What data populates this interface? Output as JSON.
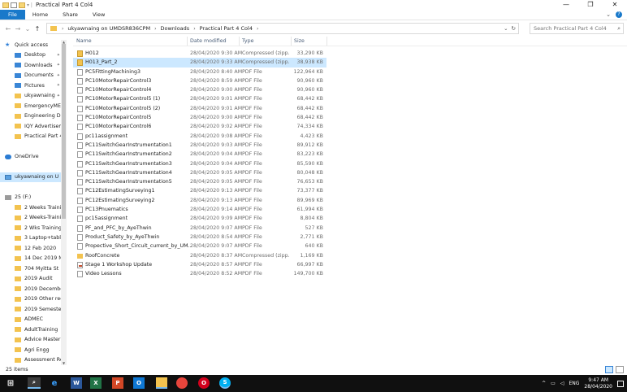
{
  "window": {
    "title": "Practical Part 4 Col4",
    "controls": [
      "—",
      "❐",
      "✕"
    ]
  },
  "ribbon": {
    "tabs": [
      "File",
      "Home",
      "Share",
      "View"
    ]
  },
  "address": {
    "path": [
      "ukyawnaing on UMDSR836CPM",
      "Downloads",
      "Practical Part 4 Col4"
    ]
  },
  "search": {
    "placeholder": "Search Practical Part 4 Col4"
  },
  "sidebar": {
    "items": [
      {
        "label": "Quick access",
        "icon": "star-icon"
      },
      {
        "label": "Desktop",
        "icon": "desktop-icon",
        "pinned": true
      },
      {
        "label": "Downloads",
        "icon": "downloads-icon",
        "pinned": true
      },
      {
        "label": "Documents",
        "icon": "documents-icon",
        "pinned": true
      },
      {
        "label": "Pictures",
        "icon": "pictures-icon",
        "pinned": true
      },
      {
        "label": "ukyawnaing",
        "icon": "folder-icon",
        "pinned": true
      },
      {
        "label": "EmergencyMEG",
        "icon": "folder-icon"
      },
      {
        "label": "Engineering Des",
        "icon": "folder-icon"
      },
      {
        "label": "IQY Advertiseme",
        "icon": "folder-icon"
      },
      {
        "label": "Practical Part 4 C",
        "icon": "folder-icon"
      },
      {
        "label": "",
        "icon": ""
      },
      {
        "label": "OneDrive",
        "icon": "onedrive-icon"
      },
      {
        "label": "",
        "icon": ""
      },
      {
        "label": "ukyawnaing on U",
        "icon": "network-drive-icon",
        "selected": true
      },
      {
        "label": "",
        "icon": ""
      },
      {
        "label": "25 (F:)",
        "icon": "drive-icon"
      },
      {
        "label": "2 Weeks Training",
        "icon": "folder-icon"
      },
      {
        "label": "2 Weeks-Trainin",
        "icon": "folder-icon"
      },
      {
        "label": "2 Wks Training D",
        "icon": "folder-icon"
      },
      {
        "label": "3 Laptop+tablet",
        "icon": "folder-icon"
      },
      {
        "label": "12 Feb 2020",
        "icon": "folder-icon"
      },
      {
        "label": "14 Dec 2019 Mya",
        "icon": "folder-icon"
      },
      {
        "label": "704 Myitta St",
        "icon": "folder-icon"
      },
      {
        "label": "2019 Audit",
        "icon": "folder-icon"
      },
      {
        "label": "2019 December",
        "icon": "folder-icon"
      },
      {
        "label": "2019 Other reco",
        "icon": "folder-icon"
      },
      {
        "label": "2019 Semester 2",
        "icon": "folder-icon"
      },
      {
        "label": "ADMEC",
        "icon": "folder-icon"
      },
      {
        "label": "AdultTraining",
        "icon": "folder-icon"
      },
      {
        "label": "Advice Master",
        "icon": "folder-icon"
      },
      {
        "label": "Agri Engg",
        "icon": "folder-icon"
      },
      {
        "label": "Assessment Reso",
        "icon": "folder-icon"
      },
      {
        "label": "AutoCAD",
        "icon": "folder-icon"
      }
    ]
  },
  "columns": {
    "name": "Name",
    "date": "Date modified",
    "type": "Type",
    "size": "Size"
  },
  "files": [
    {
      "name": "H012",
      "date": "28/04/2020 9:30 AM",
      "type": "Compressed (zipp...",
      "size": "33,290 KB",
      "kind": "zip"
    },
    {
      "name": "H013_Part_2",
      "date": "28/04/2020 9:33 AM",
      "type": "Compressed (zipp...",
      "size": "38,938 KB",
      "kind": "zip",
      "selected": true
    },
    {
      "name": "PC5FittingMachining3",
      "date": "28/04/2020 8:40 AM",
      "type": "PDF File",
      "size": "122,964 KB",
      "kind": "pdf"
    },
    {
      "name": "PC10MotorRepairControl3",
      "date": "28/04/2020 8:59 AM",
      "type": "PDF File",
      "size": "90,960 KB",
      "kind": "pdf"
    },
    {
      "name": "PC10MotorRepairControl4",
      "date": "28/04/2020 9:00 AM",
      "type": "PDF File",
      "size": "90,960 KB",
      "kind": "pdf"
    },
    {
      "name": "PC10MotorRepairControl5 (1)",
      "date": "28/04/2020 9:01 AM",
      "type": "PDF File",
      "size": "68,442 KB",
      "kind": "pdf"
    },
    {
      "name": "PC10MotorRepairControl5 (2)",
      "date": "28/04/2020 9:01 AM",
      "type": "PDF File",
      "size": "68,442 KB",
      "kind": "pdf"
    },
    {
      "name": "PC10MotorRepairControl5",
      "date": "28/04/2020 9:00 AM",
      "type": "PDF File",
      "size": "68,442 KB",
      "kind": "pdf"
    },
    {
      "name": "PC10MotorRepairControl6",
      "date": "28/04/2020 9:02 AM",
      "type": "PDF File",
      "size": "74,334 KB",
      "kind": "pdf"
    },
    {
      "name": "pc11assignment",
      "date": "28/04/2020 9:08 AM",
      "type": "PDF File",
      "size": "4,423 KB",
      "kind": "pdf"
    },
    {
      "name": "PC11SwitchGearInstrumentation1",
      "date": "28/04/2020 9:03 AM",
      "type": "PDF File",
      "size": "89,912 KB",
      "kind": "pdf"
    },
    {
      "name": "PC11SwitchGearInstrumentation2",
      "date": "28/04/2020 9:04 AM",
      "type": "PDF File",
      "size": "83,223 KB",
      "kind": "pdf"
    },
    {
      "name": "PC11SwitchGearInstrumentation3",
      "date": "28/04/2020 9:04 AM",
      "type": "PDF File",
      "size": "85,590 KB",
      "kind": "pdf"
    },
    {
      "name": "PC11SwitchGearInstrumentation4",
      "date": "28/04/2020 9:05 AM",
      "type": "PDF File",
      "size": "80,048 KB",
      "kind": "pdf"
    },
    {
      "name": "PC11SwitchGearInstrumentation5",
      "date": "28/04/2020 9:05 AM",
      "type": "PDF File",
      "size": "76,653 KB",
      "kind": "pdf"
    },
    {
      "name": "PC12EstimatingSurveying1",
      "date": "28/04/2020 9:13 AM",
      "type": "PDF File",
      "size": "73,377 KB",
      "kind": "pdf"
    },
    {
      "name": "PC12EstimatingSurveying2",
      "date": "28/04/2020 9:13 AM",
      "type": "PDF File",
      "size": "89,969 KB",
      "kind": "pdf"
    },
    {
      "name": "PC13Pnuematics",
      "date": "28/04/2020 9:14 AM",
      "type": "PDF File",
      "size": "61,994 KB",
      "kind": "pdf"
    },
    {
      "name": "pc15assignment",
      "date": "28/04/2020 9:09 AM",
      "type": "PDF File",
      "size": "8,804 KB",
      "kind": "pdf"
    },
    {
      "name": "PF_and_PFC_by_AyeThwin",
      "date": "28/04/2020 9:07 AM",
      "type": "PDF File",
      "size": "527 KB",
      "kind": "pdf"
    },
    {
      "name": "Product_Safety_by_AyeThwin",
      "date": "28/04/2020 8:54 AM",
      "type": "PDF File",
      "size": "2,771 KB",
      "kind": "pdf"
    },
    {
      "name": "Propective_Short_Circuit_current_by_UM...",
      "date": "28/04/2020 9:07 AM",
      "type": "PDF File",
      "size": "640 KB",
      "kind": "pdf"
    },
    {
      "name": "RoofConcrete",
      "date": "28/04/2020 8:37 AM",
      "type": "Compressed (zipp...",
      "size": "1,169 KB",
      "kind": "dir"
    },
    {
      "name": "Stage 1 Workshop Update",
      "date": "28/04/2020 8:57 AM",
      "type": "PDF File",
      "size": "66,997 KB",
      "kind": "ppt"
    },
    {
      "name": "Video Lessons",
      "date": "28/04/2020 8:52 AM",
      "type": "PDF File",
      "size": "149,700 KB",
      "kind": "pdf"
    }
  ],
  "status": {
    "count": "25 items"
  },
  "tray": {
    "time": "9:47 AM",
    "date": "28/04/2020",
    "lang": "ENG"
  },
  "taskbar": {
    "apps": [
      "start-icon",
      "search-icon",
      "edge-icon",
      "word-icon",
      "excel-icon",
      "powerpoint-icon",
      "outlook-icon",
      "file-explorer-icon",
      "chrome-icon",
      "opera-icon",
      "skype-icon"
    ],
    "word_glyph": "W",
    "excel_glyph": "X",
    "ppt_glyph": "P",
    "outlook_glyph": "O",
    "skype_glyph": "S"
  }
}
